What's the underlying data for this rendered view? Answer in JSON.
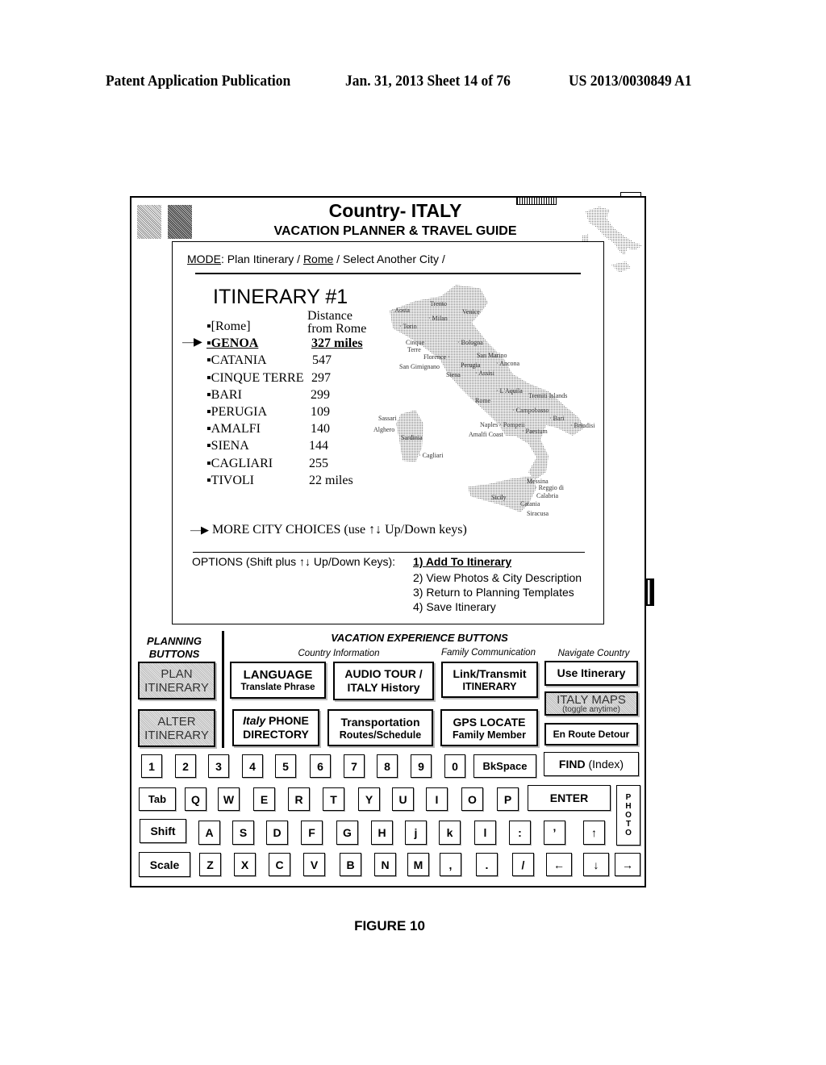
{
  "patent_header": {
    "publication": "Patent Application Publication",
    "date_sheet": "Jan. 31, 2013  Sheet 14 of 76",
    "number": "US 2013/0030849 A1"
  },
  "device": {
    "title": "Country- ITALY",
    "subtitle": "VACATION PLANNER & TRAVEL GUIDE",
    "flag_icon": "italy-flag-icon",
    "battery_icon": "battery-icon",
    "corner_map_icon": "italy-map-thumbnail-icon"
  },
  "screen": {
    "mode": {
      "label": "MODE",
      "sep1": ": Plan Itinerary / ",
      "city": "Rome",
      "sep2": " / Select Another City /"
    },
    "itinerary_title": "ITINERARY #1",
    "distance_header_1": "Distance",
    "distance_header_2": "from Rome",
    "cities": [
      {
        "name": "▪[Rome]",
        "distance": ""
      },
      {
        "name": "▪GENOA",
        "distance": "327 miles",
        "selected": true
      },
      {
        "name": "▪CATANIA",
        "distance": "547"
      },
      {
        "name": "▪CINQUE TERRE",
        "distance": "297"
      },
      {
        "name": "▪BARI",
        "distance": "299"
      },
      {
        "name": "▪PERUGIA",
        "distance": "109"
      },
      {
        "name": "▪AMALFI",
        "distance": "140"
      },
      {
        "name": "▪SIENA",
        "distance": "144"
      },
      {
        "name": "▪CAGLIARI",
        "distance": "255"
      },
      {
        "name": "▪TIVOLI",
        "distance": "22 miles"
      }
    ],
    "selection_arrow": "—▶",
    "more_choices": "MORE CITY CHOICES (use ↑↓ Up/Down keys)",
    "options_label": "OPTIONS (Shift plus ↑↓ Up/Down  Keys):",
    "options": [
      "1) Add To Itinerary",
      "2) View Photos & City Description",
      "3) Return to Planning Templates",
      "4) Save Itinerary"
    ],
    "map_labels": [
      "Aosta",
      "Trento",
      "Venice",
      "Milan",
      "Torin",
      "Cinque Terre",
      "Bologna",
      "San Marino",
      "Ancona",
      "Florence",
      "San Gimignano",
      "Perugia",
      "Siena",
      "Assisi",
      "L'Aquila",
      "Tremiti Islands",
      "Rome",
      "Campobasso",
      "Bari",
      "Naples",
      "Pompeii",
      "Brindisi",
      "Amalfi Coast",
      "Paestum",
      "Sassari",
      "Alghero",
      "Sardinia",
      "Cagliari",
      "Messina",
      "Reggio di Calabria",
      "Sicily",
      "Catania",
      "Siracusa"
    ]
  },
  "planning": {
    "heading_1": "PLANNING",
    "heading_2": "BUTTONS",
    "plan_1": "PLAN",
    "plan_2": "ITINERARY",
    "alter_1": "ALTER",
    "alter_2": "ITINERARY"
  },
  "experience": {
    "heading": "VACATION EXPERIENCE BUTTONS",
    "cat_country": "Country Information",
    "cat_family": "Family Communication",
    "cat_navigate": "Navigate Country",
    "language_1": "LANGUAGE",
    "language_2": "Translate Phrase",
    "audio_1": "AUDIO TOUR /",
    "audio_2": "ITALY History",
    "link_1": "Link/Transmit",
    "link_2": "ITINERARY",
    "use_itinerary": "Use Itinerary",
    "phone_italic": "Italy",
    "phone_1": " PHONE",
    "phone_2": "DIRECTORY",
    "transport_1": "Transportation",
    "transport_2": "Routes/Schedule",
    "gps_1": "GPS LOCATE",
    "gps_2": "Family Member",
    "maps_1": "ITALY MAPS",
    "maps_2": "(toggle anytime)",
    "detour": "En Route Detour"
  },
  "keyboard": {
    "row1": [
      "1",
      "2",
      "3",
      "4",
      "5",
      "6",
      "7",
      "8",
      "9",
      "0"
    ],
    "bkspace": "BkSpace",
    "find_bold": "FIND",
    "find_rest": " (Index)",
    "tab": "Tab",
    "row2": [
      "Q",
      "W",
      "E",
      "R",
      "T",
      "Y",
      "U",
      "I",
      "O",
      "P"
    ],
    "enter": "ENTER",
    "photo": [
      "P",
      "H",
      "O",
      "T",
      "O"
    ],
    "shift": "Shift",
    "row3": [
      "A",
      "S",
      "D",
      "F",
      "G",
      "H",
      "j",
      "k",
      "l",
      ":",
      "’",
      "↑"
    ],
    "scale": "Scale",
    "row4": [
      "Z",
      "X",
      "C",
      "V",
      "B",
      "N",
      "M",
      ",",
      ".",
      "/",
      "←",
      "↓",
      "→"
    ]
  },
  "figure_caption": "FIGURE 10"
}
